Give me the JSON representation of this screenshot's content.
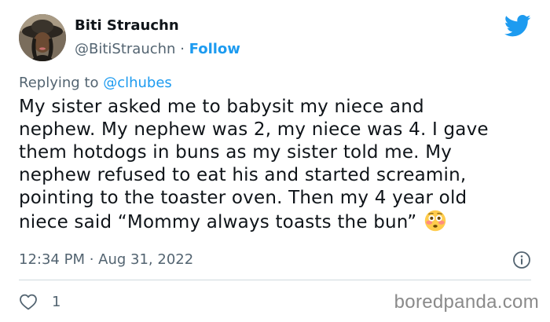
{
  "author": {
    "display_name": "Biti Strauchn",
    "handle": "@BitiStrauchn",
    "separator": "·",
    "follow_label": "Follow"
  },
  "reply": {
    "prefix": "Replying to ",
    "mention": "@clhubes"
  },
  "tweet": {
    "text": "My sister asked me to babysit my niece and\nnephew. My nephew was 2, my niece was 4. I gave\nthem hotdogs in buns as my sister told me. My\nnephew refused to eat his and started screamin,\npointing to the toaster oven. Then my 4 year old\nniece said “Mommy always toasts the bun” ",
    "emoji": "flushed-face-icon"
  },
  "meta": {
    "timestamp": "12:34 PM · Aug 31, 2022"
  },
  "engagement": {
    "likes": "1"
  },
  "watermark": "boredpanda.com",
  "colors": {
    "accent": "#1d9bf0",
    "secondary_text": "#536471",
    "divider": "#cfd9de",
    "text": "#0f1419"
  },
  "icons": {
    "brand": "twitter-bird-icon",
    "info": "info-icon",
    "like": "heart-icon"
  }
}
